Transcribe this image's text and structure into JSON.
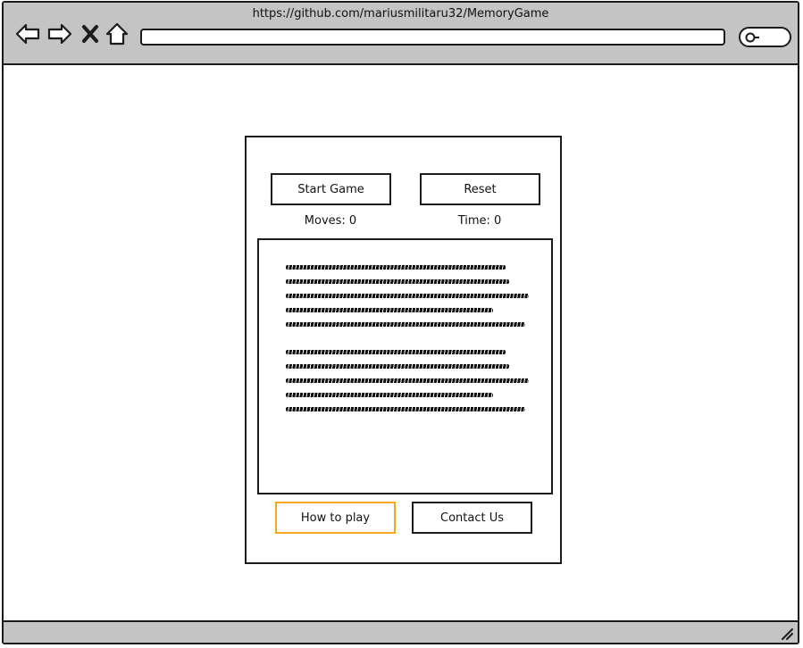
{
  "browser": {
    "url": "https://github.com/mariusmilitaru32/MemoryGame",
    "icons": {
      "back": "back-arrow-icon",
      "forward": "forward-arrow-icon",
      "stop": "close-icon",
      "home": "home-icon",
      "search": "search-icon",
      "resize": "resize-grip-icon"
    }
  },
  "game": {
    "start_label": "Start Game",
    "reset_label": "Reset",
    "moves_label": "Moves: 0",
    "time_label": "Time: 0",
    "how_to_play_label": "How to play",
    "contact_label": "Contact Us"
  },
  "colors": {
    "chrome": "#c4c4c4",
    "outline": "#1c1c1c",
    "highlight": "#f5a623"
  }
}
